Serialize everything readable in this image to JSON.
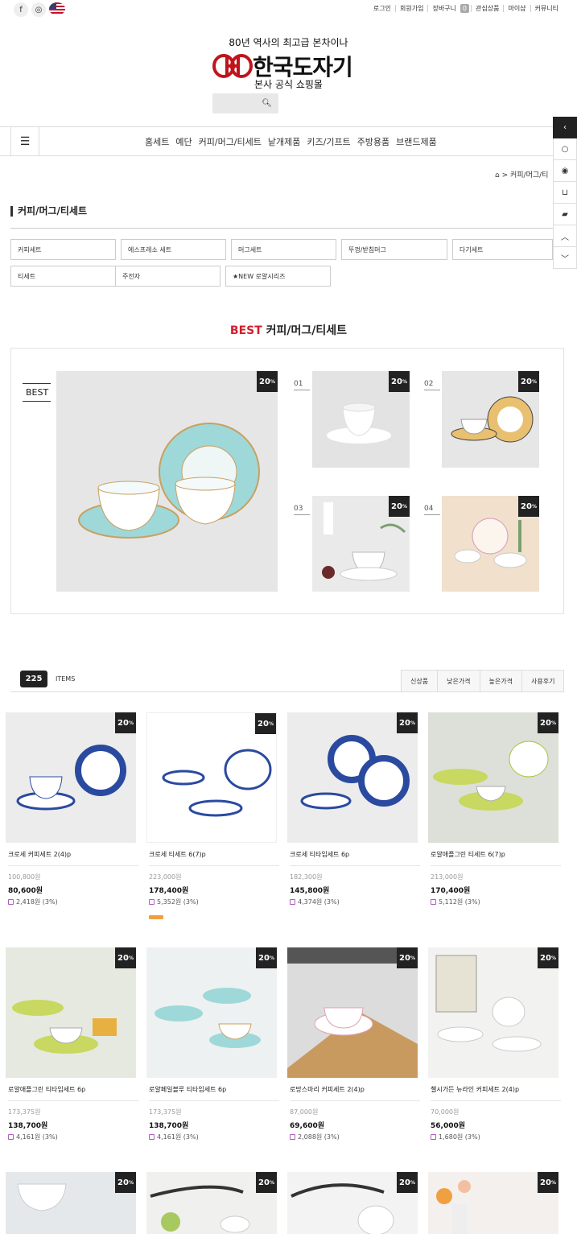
{
  "top": {
    "sns": [
      "f",
      "◎"
    ],
    "menu": {
      "login": "로그인",
      "join": "회원가입",
      "cart": "장바구니",
      "cart_count": "0",
      "wishlist": "관심상품",
      "mypage": "마이샵",
      "community": "커뮤니티"
    }
  },
  "brand": {
    "tagline": "80년 역사의 최고급 본차이나",
    "name": "한국도자기",
    "sub": "본사 공식 쇼핑몰"
  },
  "nav": [
    "홈세트",
    "예단",
    "커피/머그/티세트",
    "낱개제품",
    "키즈/기프트",
    "주방용품",
    "브랜드제품"
  ],
  "breadcrumb": "커피/머그/티",
  "category": {
    "title": "커피/머그/티세트",
    "subs": [
      "커피세트",
      "에스프레소 세트",
      "머그세트",
      "뚜껑/받침머그",
      "다기세트",
      "티세트",
      "주전자",
      "★NEW 로얄시리즈"
    ]
  },
  "best": {
    "title_accent": "BEST",
    "title": "커피/머그/티세트",
    "label": "BEST",
    "badge": "20",
    "badge_unit": "%",
    "nums": [
      "01",
      "02",
      "03",
      "04"
    ]
  },
  "list": {
    "count": "225",
    "count_label": "ITEMS",
    "sorts": [
      "신상품",
      "낮은가격",
      "높은가격",
      "사용후기"
    ],
    "products": [
      {
        "name": "크로세 커피세트 2(4)p",
        "orig": "100,800원",
        "price": "80,600원",
        "point": "2,418원 (3%)"
      },
      {
        "name": "크로세 티세트 6(7)p",
        "orig": "223,000원",
        "price": "178,400원",
        "point": "5,352원 (3%)"
      },
      {
        "name": "크로세 티타임세트 6p",
        "orig": "182,300원",
        "price": "145,800원",
        "point": "4,374원 (3%)"
      },
      {
        "name": "로얄애플그린 티세트 6(7)p",
        "orig": "213,000원",
        "price": "170,400원",
        "point": "5,112원 (3%)"
      },
      {
        "name": "로얄애플그린 티타임세트 6p",
        "orig": "173,375원",
        "price": "138,700원",
        "point": "4,161원 (3%)"
      },
      {
        "name": "로얄페일블루 티타임세트 6p",
        "orig": "173,375원",
        "price": "138,700원",
        "point": "4,161원 (3%)"
      },
      {
        "name": "로망스마리 커피세트 2(4)p",
        "orig": "87,000원",
        "price": "69,600원",
        "point": "2,088원 (3%)"
      },
      {
        "name": "첼시가든 뉴라인 커피세트 2(4)p",
        "orig": "70,000원",
        "price": "56,000원",
        "point": "1,680원 (3%)"
      }
    ]
  },
  "colors": {
    "accent": "#d01f2a",
    "dark": "#222222",
    "badge": "#222222"
  }
}
